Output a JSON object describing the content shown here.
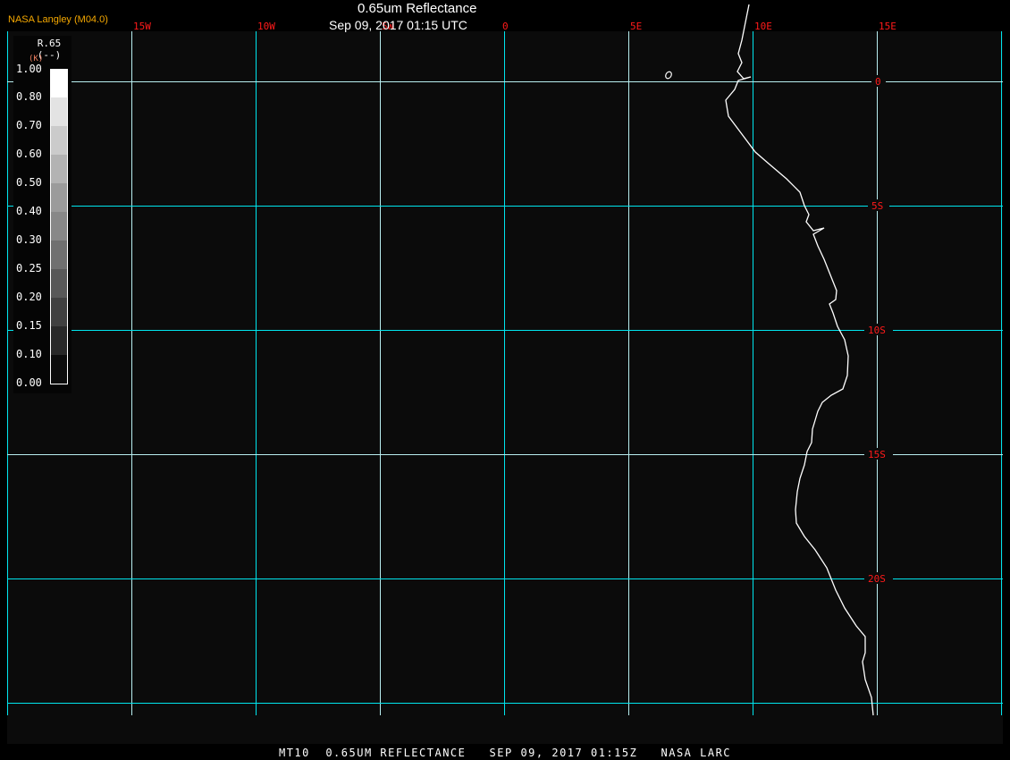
{
  "header": {
    "title": "0.65um Reflectance",
    "subtitle": "Sep 09, 2017 01:15 UTC",
    "brand": "NASA Langley (M04.0)"
  },
  "footer": {
    "text": "MT10  0.65UM REFLECTANCE   SEP 09, 2017 01:15Z   NASA LARC"
  },
  "colors": {
    "background": "#0b0b0b",
    "grid": "#00e5ee",
    "grid_light": "#b8eef0",
    "grid_labels": "#ff1a1a",
    "coastline": "#ffffff"
  },
  "map": {
    "longitude_labels": [
      "15W",
      "10W",
      "5W",
      "0",
      "5E",
      "10E",
      "15E"
    ],
    "latitude_labels": [
      "0",
      "5S",
      "10S",
      "15S",
      "20S"
    ],
    "longitudes": [
      -20,
      -15,
      -10,
      -5,
      0,
      5,
      10,
      15,
      20
    ],
    "latitudes": [
      0,
      -5,
      -10,
      -15,
      -20,
      -25
    ]
  },
  "legend": {
    "variable": "R.65",
    "units": "(--)",
    "units_overlay": "(K)",
    "labels": [
      "1.00",
      "0.80",
      "0.70",
      "0.60",
      "0.50",
      "0.40",
      "0.30",
      "0.25",
      "0.20",
      "0.15",
      "0.10",
      "0.00"
    ],
    "colors": [
      "#ffffff",
      "#e3e3e3",
      "#cbcbcb",
      "#b3b3b3",
      "#9b9b9b",
      "#888888",
      "#707070",
      "#585858",
      "#404040",
      "#282828",
      "#0c0c0c"
    ]
  }
}
